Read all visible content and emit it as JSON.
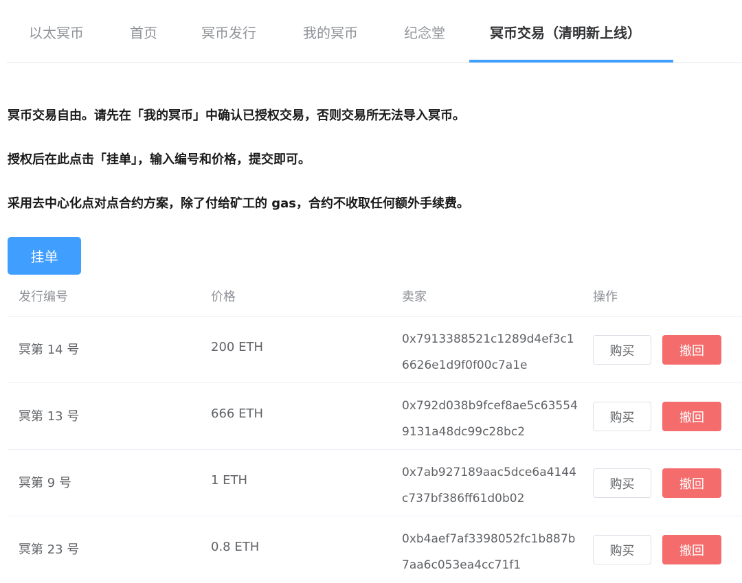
{
  "nav": {
    "tabs": [
      {
        "label": "以太冥币"
      },
      {
        "label": "首页"
      },
      {
        "label": "冥币发行"
      },
      {
        "label": "我的冥币"
      },
      {
        "label": "纪念堂"
      },
      {
        "label": "冥币交易（清明新上线）"
      }
    ],
    "active_tab": "冥币交易（清明新上线）"
  },
  "notices": [
    "冥币交易自由。请先在「我的冥币」中确认已授权交易，否则交易所无法导入冥币。",
    "授权后在此点击「挂单」，输入编号和价格，提交即可。",
    "采用去中心化点对点合约方案，除了付给矿工的 gas，合约不收取任何额外手续费。"
  ],
  "list_button": "挂单",
  "table": {
    "headers": [
      "发行编号",
      "价格",
      "卖家",
      "操作"
    ],
    "rows": [
      {
        "id": "冥第 14 号",
        "price": "200 ETH",
        "seller": "0x7913388521c1289d4ef3c16626e1d9f0f00c7a1e",
        "buy": "购买",
        "revoke": "撤回"
      },
      {
        "id": "冥第 13 号",
        "price": "666 ETH",
        "seller": "0x792d038b9fcef8ae5c635549131a48dc99c28bc2",
        "buy": "购买",
        "revoke": "撤回"
      },
      {
        "id": "冥第 9 号",
        "price": "1 ETH",
        "seller": "0x7ab927189aac5dce6a4144c737bf386ff61d0b02",
        "buy": "购买",
        "revoke": "撤回"
      },
      {
        "id": "冥第 23 号",
        "price": "0.8 ETH",
        "seller": "0xb4aef7af3398052fc1b887b7aa6c053ea4cc71f1",
        "buy": "购买",
        "revoke": "撤回"
      }
    ]
  },
  "colors": {
    "primary": "#409eff",
    "danger": "#f56c6c",
    "border": "#ebeef5"
  }
}
